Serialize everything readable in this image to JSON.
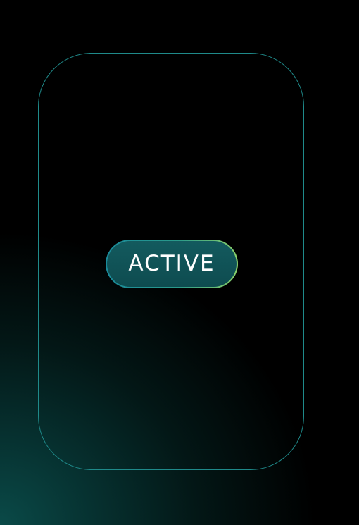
{
  "status": {
    "label": "ACTIVE"
  },
  "colors": {
    "card_border": "#1f8a8a",
    "pill_fill": "#125458",
    "pill_border_start": "#1a8a9a",
    "pill_border_end": "#8ad06a",
    "text": "#ffffff",
    "background": "#000000",
    "background_glow": "#0a4a48"
  }
}
